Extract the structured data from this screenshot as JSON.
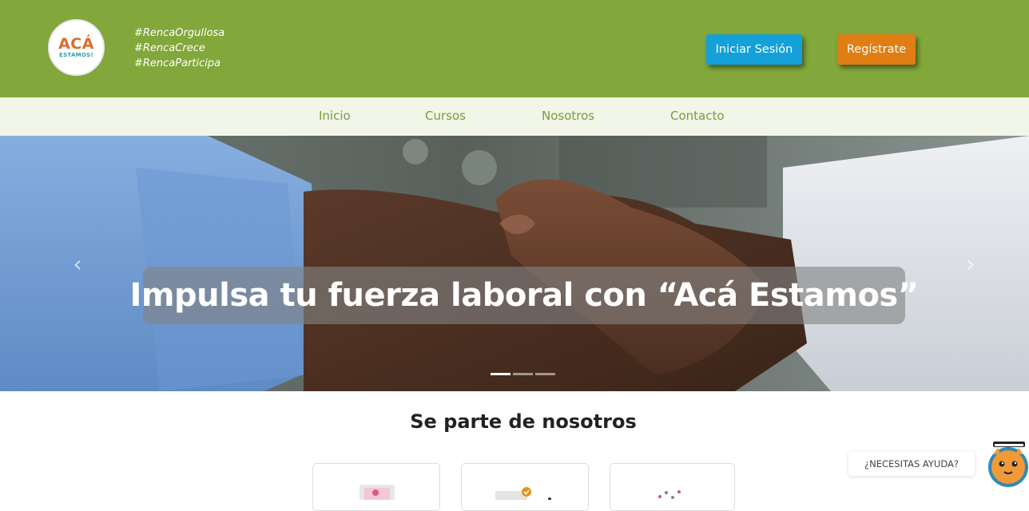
{
  "header": {
    "logo": {
      "main": "ACÁ",
      "sub": "ESTAMOS!"
    },
    "hashtags": [
      "#RencaOrgullosa",
      "#RencaCrece",
      "#RencaParticipa"
    ],
    "login_label": "Iniciar Sesión",
    "register_label": "Regístrate"
  },
  "nav": {
    "items": [
      {
        "label": "Inicio"
      },
      {
        "label": "Cursos"
      },
      {
        "label": "Nosotros"
      },
      {
        "label": "Contacto"
      }
    ]
  },
  "hero": {
    "caption": "Impulsa tu fuerza laboral con “Acá Estamos”",
    "prev_icon": "chevron-left-icon",
    "next_icon": "chevron-right-icon",
    "prev_glyph": "‹",
    "next_glyph": "›",
    "slides": 3,
    "active_slide": 1
  },
  "section": {
    "title": "Se parte de nosotros"
  },
  "help": {
    "label": "¿NECESITAS AYUDA?"
  },
  "colors": {
    "header_bg": "#82a73a",
    "nav_bg": "#f1f6e8",
    "nav_text": "#7b9a40",
    "login_bg": "#14a0d9",
    "register_bg": "#e07d13",
    "logo_orange": "#e0692a",
    "logo_teal": "#2e9fa8"
  }
}
